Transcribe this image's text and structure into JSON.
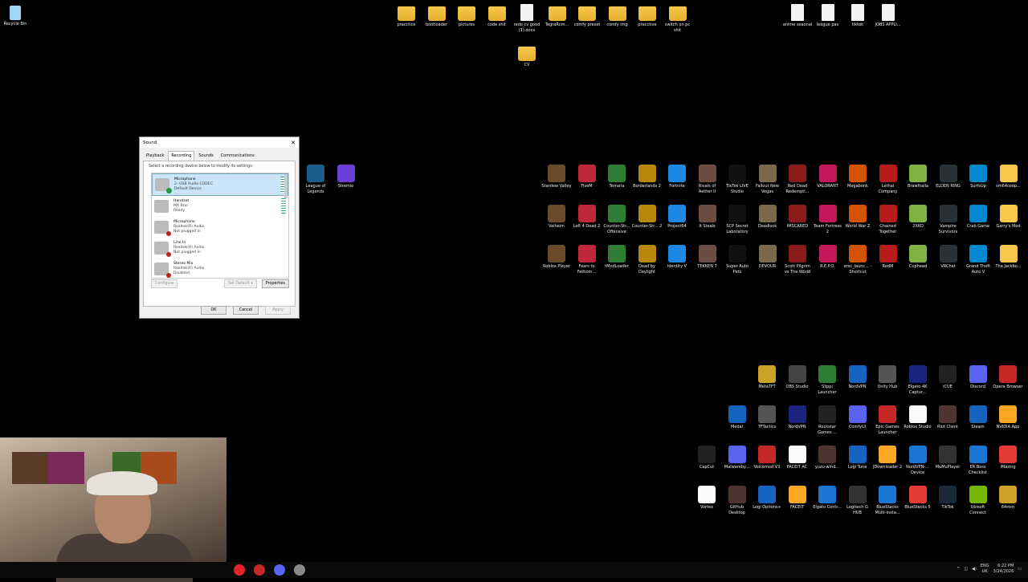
{
  "desktop_top_left": [
    {
      "label": "Recycle Bin",
      "kind": "bin"
    }
  ],
  "desktop_top_files": [
    {
      "label": "pracctice",
      "kind": "folder"
    },
    {
      "label": "bootloader",
      "kind": "folder"
    },
    {
      "label": "pictures",
      "kind": "folder"
    },
    {
      "label": "code shit",
      "kind": "folder"
    },
    {
      "label": "redo cv good (1).docx",
      "kind": "file"
    },
    {
      "label": "TegraRcm...",
      "kind": "folder"
    },
    {
      "label": "comfy preset",
      "kind": "folder"
    },
    {
      "label": "comfy img",
      "kind": "folder"
    },
    {
      "label": "pracctive",
      "kind": "folder"
    },
    {
      "label": "switch on pc shit",
      "kind": "folder"
    }
  ],
  "desktop_cv": {
    "label": "CV",
    "kind": "folder"
  },
  "desktop_top_right": [
    {
      "label": "anime seaonal",
      "kind": "file"
    },
    {
      "label": "league pas",
      "kind": "file"
    },
    {
      "label": "tiktok",
      "kind": "file"
    },
    {
      "label": "JOBS APPLI...",
      "kind": "file"
    }
  ],
  "desktop_mid": [
    {
      "label": "League of Legends",
      "color": "#1b5e8a"
    },
    {
      "label": "Stremio",
      "color": "#6a3fd8"
    }
  ],
  "games_grid": [
    [
      "Stardew Valley",
      "FiveM",
      "Terraria",
      "Borderlands 2",
      "Fortnite",
      "Rivals of Aether II",
      "TikTok LIVE Studio",
      "Fallout New Vegas",
      "Red Dead Redempti...",
      "VALORANT",
      "Megabonk",
      "Lethal Company",
      "Brawlhalla",
      "ELDEN RING",
      "SurfsUp",
      "sm64coop..."
    ],
    [
      "Valheim",
      "Left 4 Dead 2",
      "Counter-Str... Offensive",
      "Counter-Str... 2",
      "Project64",
      "It Steals",
      "SCP Secret Laboratory",
      "Deadlock",
      "IMSCARED",
      "Team Fortress 2",
      "World War Z",
      "Chained Together",
      "2XKO",
      "Vampire Survivors",
      "Crab Game",
      "Garry's Mod"
    ],
    [
      "Roblox Player",
      "Fears to Fathom...",
      "tModLoader",
      "Dead by Daylight",
      "Identity V",
      "TEKKEN 7",
      "Super Auto Pets",
      "DEVOUR",
      "Scott Pilgrim vs The World",
      "R.E.P.O.",
      "ersc_launc... - Shortcut",
      "RedM",
      "Cuphead",
      "VRChat",
      "Grand Theft Auto V",
      "The.Jackbo..."
    ]
  ],
  "games_grid_colors": [
    "#6a4a2a",
    "#c0273b",
    "#2e7d32",
    "#b8860b",
    "#1e88e5",
    "#6d4c41",
    "#111",
    "#7a6a4a",
    "#8b1a1a",
    "#c2185b",
    "#d35400",
    "#b71c1c",
    "#7cb342",
    "#263238",
    "#0288d1",
    "#f5c84c"
  ],
  "apps_grid": [
    [
      "MetaTFT",
      "OBS Studio",
      "Slippi Launcher",
      "NordVPN",
      "Unity Hub",
      "Elgato 4K Captur...",
      "iCUE",
      "Discord",
      "Opera Browser"
    ],
    [
      "Medal",
      "TFTactics",
      "NordVPN",
      "Rockstar Games ...",
      "ComfyUI",
      "Epic Games Launcher",
      "Roblox Studio",
      "Riot Client",
      "Steam",
      "NVIDIA App"
    ],
    [
      "CapCut",
      "Malwareby...",
      "Voicemod V3",
      "FACEIT AC",
      "yuzu-wind...",
      "Logi Tune",
      "JDownloader 2",
      "NordVPN-... Device",
      "MuMuPlayer",
      "ER Boss Checklist",
      "iMazing"
    ],
    [
      "Vortex",
      "GitHub Desktop",
      "Logi Options+",
      "FACEIT",
      "Elgato Contr...",
      "Logitech G HUB",
      "BlueStacks Multi-Insta...",
      "BlueStacks 5",
      "TikTok",
      "Ubisoft Connect",
      "64rom"
    ]
  ],
  "apps_grid_colors": [
    "#c9a227",
    "#444",
    "#2e7d32",
    "#1565c0",
    "#555",
    "#1a237e",
    "#222",
    "#5865f2",
    "#c62828",
    "#fafafa",
    "#4e342e",
    "#1565c0",
    "#f9a825",
    "#1976d2",
    "#333",
    "#1976d2",
    "#e53935",
    "#1b2838",
    "#76b900"
  ],
  "sound_dialog": {
    "title": "Sound",
    "close": "✕",
    "tabs": [
      "Playback",
      "Recording",
      "Sounds",
      "Communications"
    ],
    "instruction": "Select a recording device below to modify its settings:",
    "devices": [
      {
        "name": "Microphone",
        "line2": "2- USB Audio CODEC",
        "line3": "Default Device",
        "status": "ok",
        "selected": true
      },
      {
        "name": "Handset",
        "line2": "MX Brio",
        "line3": "Ready",
        "status": "none",
        "selected": false
      },
      {
        "name": "Microphone",
        "line2": "Realtek(R) Audio",
        "line3": "Not plugged in",
        "status": "down",
        "selected": false
      },
      {
        "name": "Line In",
        "line2": "Realtek(R) Audio",
        "line3": "Not plugged in",
        "status": "down",
        "selected": false
      },
      {
        "name": "Stereo Mix",
        "line2": "Realtek(R) Audio",
        "line3": "Disabled",
        "status": "down",
        "selected": false
      }
    ],
    "configure_label": "Configure",
    "set_default_label": "Set Default",
    "properties_label": "Properties",
    "ok_label": "OK",
    "cancel_label": "Cancel",
    "apply_label": "Apply"
  },
  "taskbar": {
    "apps": [
      {
        "name": "opera-gx-icon",
        "color": "#e5232b"
      },
      {
        "name": "app-icon",
        "color": "#c62828"
      },
      {
        "name": "discord-icon",
        "color": "#5865f2"
      },
      {
        "name": "app-icon-2",
        "color": "#8a8a8a"
      }
    ],
    "lang_top": "ENG",
    "lang_bottom": "UK",
    "time": "6:22 PM",
    "date": "3/24/2026"
  }
}
